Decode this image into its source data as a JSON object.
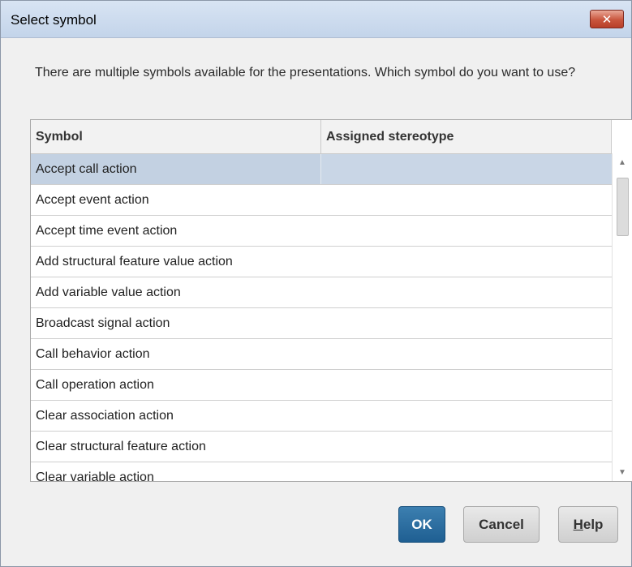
{
  "dialog": {
    "title": "Select symbol",
    "close_glyph": "✕",
    "message": "There are multiple symbols available for the presentations. Which symbol do you want to use?"
  },
  "table": {
    "columns": [
      "Symbol",
      "Assigned stereotype"
    ],
    "rows": [
      {
        "symbol": "Accept call action",
        "stereotype": "",
        "selected": true
      },
      {
        "symbol": "Accept event action",
        "stereotype": ""
      },
      {
        "symbol": "Accept time event action",
        "stereotype": ""
      },
      {
        "symbol": "Add structural feature value action",
        "stereotype": ""
      },
      {
        "symbol": "Add variable value action",
        "stereotype": ""
      },
      {
        "symbol": "Broadcast signal action",
        "stereotype": ""
      },
      {
        "symbol": "Call behavior action",
        "stereotype": ""
      },
      {
        "symbol": "Call operation action",
        "stereotype": ""
      },
      {
        "symbol": "Clear association action",
        "stereotype": ""
      },
      {
        "symbol": "Clear structural feature action",
        "stereotype": ""
      },
      {
        "symbol": "Clear variable action",
        "stereotype": ""
      }
    ]
  },
  "scrollbar": {
    "up_glyph": "▲",
    "down_glyph": "▼"
  },
  "buttons": {
    "ok": "OK",
    "cancel": "Cancel",
    "help_first": "H",
    "help_rest": "elp"
  },
  "colors": {
    "selection": "#c3d1e2",
    "primary_button": "#2a6ea3",
    "title_bar": "#c9d9ee",
    "close_button": "#c9553d"
  }
}
